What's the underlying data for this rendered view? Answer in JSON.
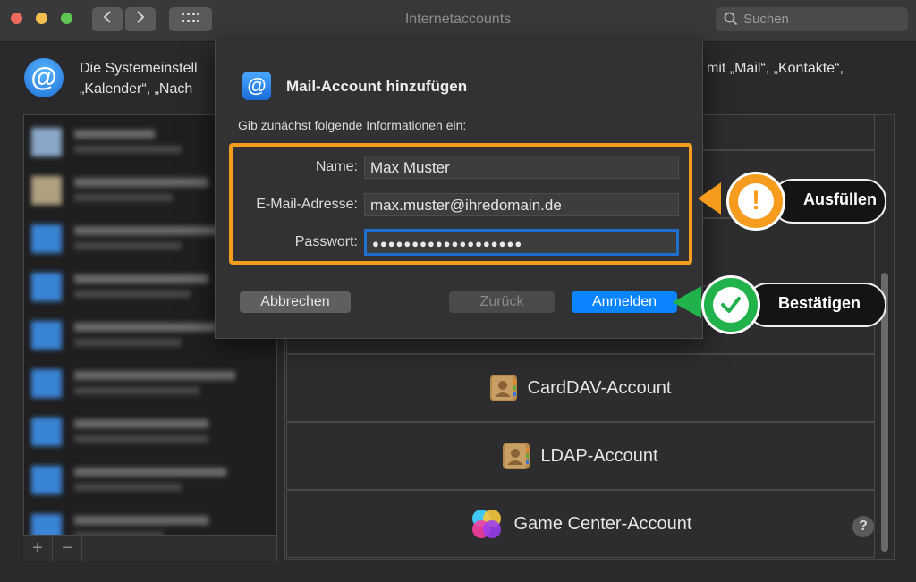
{
  "window": {
    "title": "Internetaccounts"
  },
  "titlebar": {
    "search_placeholder": "Suchen"
  },
  "info": {
    "line1_left": "Die Systemeinstell",
    "line1_right": "mit „Mail“, „Kontakte“,",
    "line2_left": "„Kalender“, „Nach"
  },
  "dialog": {
    "title": "Mail-Account hinzufügen",
    "subtitle": "Gib zunächst folgende Informationen ein:",
    "name_label": "Name:",
    "name_value": "Max Muster",
    "email_label": "E-Mail-Adresse:",
    "email_value": "max.muster@ihredomain.de",
    "password_label": "Passwort:",
    "password_value": "●●●●●●●●●●●●●●●●●●●",
    "cancel_label": "Abbrechen",
    "back_label": "Zurück",
    "signin_label": "Anmelden"
  },
  "callouts": {
    "fill_label": "Ausfüllen",
    "confirm_label": "Bestätigen"
  },
  "providers": [
    {
      "label": "CardDAV-Account",
      "icon": "contacts-icon"
    },
    {
      "label": "LDAP-Account",
      "icon": "contacts-icon"
    },
    {
      "label": "Game Center-Account",
      "icon": "game-center-icon"
    }
  ],
  "sidebar_footer": {
    "add": "+",
    "remove": "−"
  },
  "help": "?",
  "colors": {
    "accent": "#0a84ff",
    "highlight": "#f59b1d",
    "confirm": "#22b24c"
  }
}
